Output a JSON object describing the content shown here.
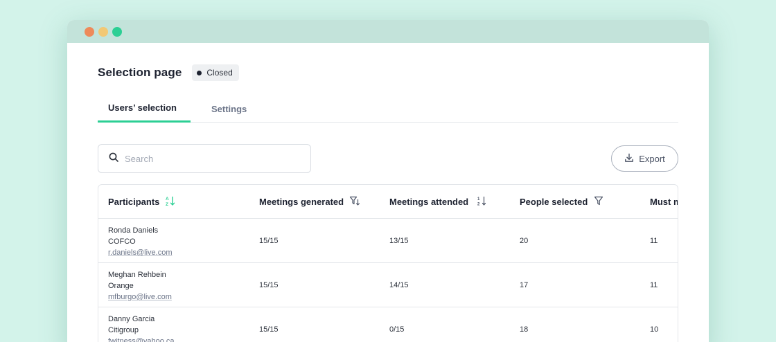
{
  "window": {
    "controls": [
      {
        "name": "close",
        "color": "#ee8a5a"
      },
      {
        "name": "minimize",
        "color": "#f2c874"
      },
      {
        "name": "maximize",
        "color": "#2ccf94"
      }
    ]
  },
  "page": {
    "title": "Selection page",
    "status": "Closed"
  },
  "tabs": [
    {
      "label": "Users’ selection",
      "active": true
    },
    {
      "label": "Settings",
      "active": false
    }
  ],
  "search": {
    "placeholder": "Search",
    "value": ""
  },
  "export": {
    "label": "Export"
  },
  "table": {
    "columns": [
      {
        "label": "Participants",
        "icon": "sort-alpha-icon"
      },
      {
        "label": "Meetings generated",
        "icon": "filter-sort-icon"
      },
      {
        "label": "Meetings attended",
        "icon": "sort-numeric-icon"
      },
      {
        "label": "People selected",
        "icon": "filter-icon"
      },
      {
        "label": "Must m"
      }
    ],
    "rows": [
      {
        "name": "Ronda Daniels",
        "company": "COFCO",
        "email": "r.daniels@live.com",
        "generated": "15/15",
        "attended": "13/15",
        "selected": "20",
        "must": "11"
      },
      {
        "name": "Meghan Rehbein",
        "company": "Orange",
        "email": "mfburgo@live.com",
        "generated": "15/15",
        "attended": "14/15",
        "selected": "17",
        "must": "11"
      },
      {
        "name": "Danny Garcia",
        "company": "Citigroup",
        "email": "fwitness@yahoo.ca",
        "generated": "15/15",
        "attended": "0/15",
        "selected": "18",
        "must": "10"
      }
    ]
  },
  "colors": {
    "accent": "#2ccf94",
    "background": "#d3f3ea",
    "titlebar": "#c3e3da"
  }
}
